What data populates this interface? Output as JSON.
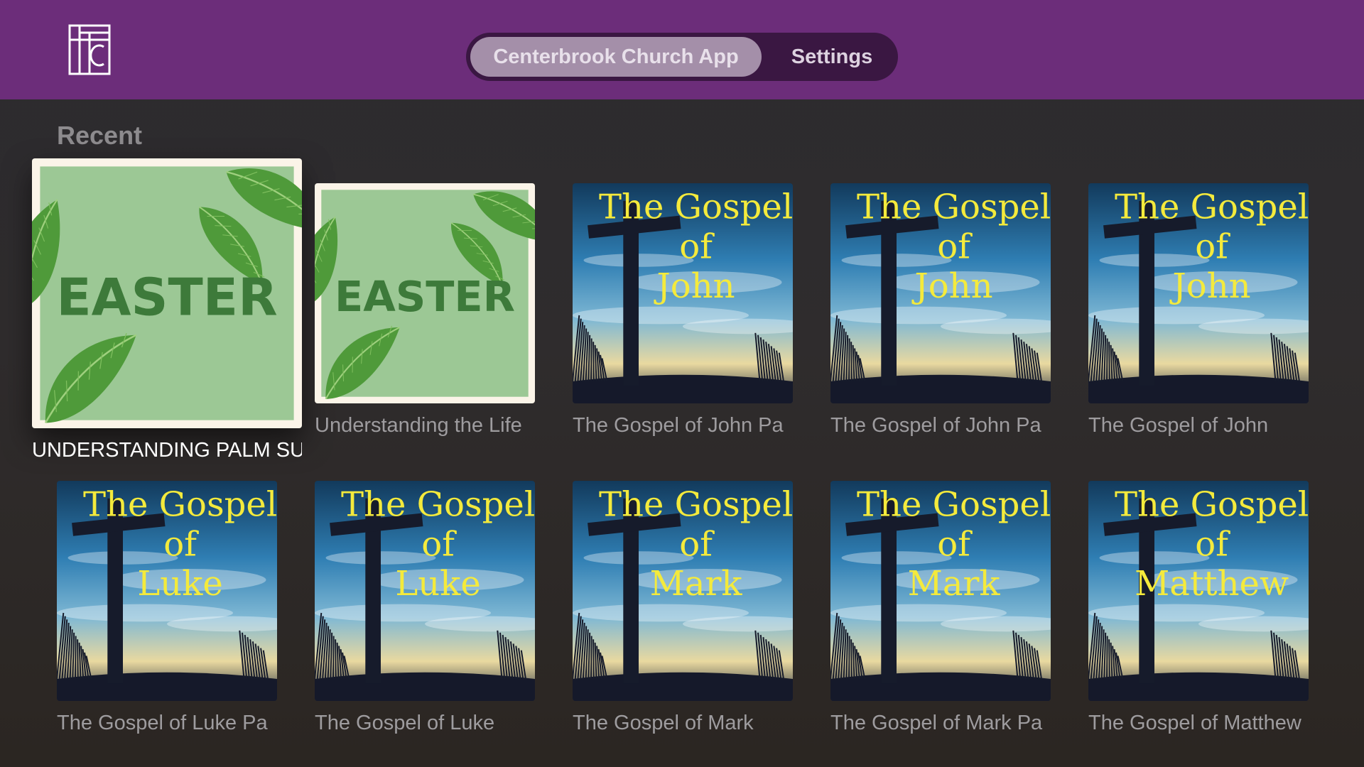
{
  "header": {
    "logo_icon": "church-logo-icon",
    "tabs": [
      {
        "label": "Centerbrook Church App",
        "selected": true
      },
      {
        "label": "Settings",
        "selected": false
      }
    ],
    "colors": {
      "bar": "#6c2d7a",
      "tab_track": "#3a1742",
      "tab_selected": "#a48fa9"
    }
  },
  "section": {
    "title": "Recent"
  },
  "artwork_text": {
    "easter": "EASTER",
    "gospel_line1": "The Gospel",
    "gospel_line2": "of"
  },
  "items": [
    {
      "caption": "UNDERSTANDING PALM SU",
      "art": "easter",
      "focused": true
    },
    {
      "caption": "Understanding the Life",
      "art": "easter"
    },
    {
      "caption": "The Gospel of John Pa",
      "art": "gospel",
      "book": "John"
    },
    {
      "caption": "The Gospel of John Pa",
      "art": "gospel",
      "book": "John"
    },
    {
      "caption": "The Gospel of John",
      "art": "gospel",
      "book": "John"
    },
    {
      "caption": "The Gospel of Luke Pa",
      "art": "gospel",
      "book": "Luke"
    },
    {
      "caption": "The Gospel of Luke",
      "art": "gospel",
      "book": "Luke"
    },
    {
      "caption": "The Gospel of Mark",
      "art": "gospel",
      "book": "Mark"
    },
    {
      "caption": "The Gospel of Mark Pa",
      "art": "gospel",
      "book": "Mark"
    },
    {
      "caption": "The Gospel of Matthew",
      "art": "gospel",
      "book": "Matthew"
    }
  ]
}
